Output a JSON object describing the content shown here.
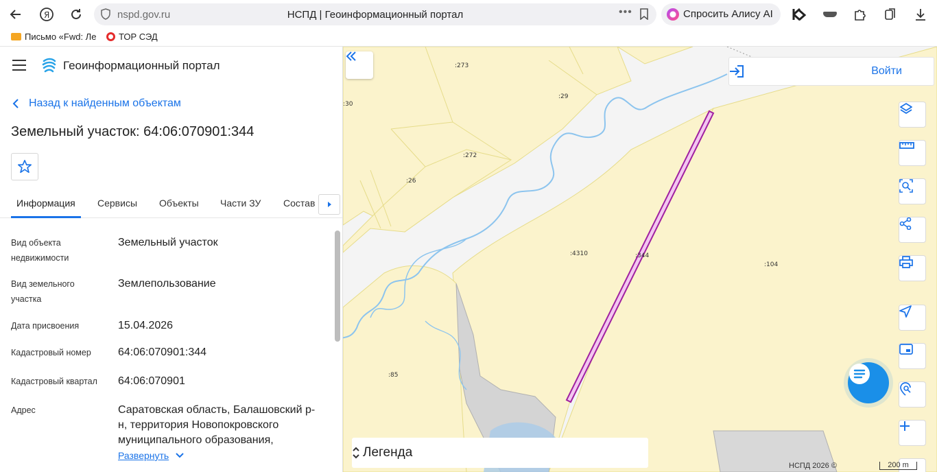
{
  "browser": {
    "url": "nspd.gov.ru",
    "tab_title": "НСПД | Геоинформационный портал",
    "alice_label": "Спросить Алису AI",
    "bookmarks": [
      "Письмо «Fwd: Ле",
      "ТОР СЭД"
    ]
  },
  "panel": {
    "portal_title": "Геоинформационный портал",
    "back_label": "Назад к найденным объектам",
    "object_title": "Земельный участок: 64:06:070901:344",
    "tabs": [
      "Информация",
      "Сервисы",
      "Объекты",
      "Части ЗУ",
      "Состав"
    ],
    "active_tab": "Информация",
    "rows": [
      {
        "label": "Вид объекта недвижимости",
        "value": "Земельный участок"
      },
      {
        "label": "Вид земельного участка",
        "value": "Землепользование"
      },
      {
        "label": "Дата присвоения",
        "value": "15.04.2026"
      },
      {
        "label": "Кадастровый номер",
        "value": "64:06:070901:344"
      },
      {
        "label": "Кадастровый квартал",
        "value": "64:06:070901"
      },
      {
        "label": "Адрес",
        "value": "Саратовская область, Балашовский р-н, территория Новопокровского муниципального образования,"
      }
    ],
    "expand_label": "Развернуть"
  },
  "map": {
    "login_label": "Войти",
    "legend_label": "Легенда",
    "copyright": "НСПД 2026 ©",
    "scale": "200 m",
    "parcel_labels": [
      ":273",
      ":29",
      ":30",
      ":272",
      ":26",
      ":4310",
      ":344",
      ":104",
      ":85"
    ],
    "colors": {
      "parcel_fill": "#fbf3cc",
      "parcel_border": "#e6dc8a",
      "river": "#8cc4ee",
      "highlight": "#a020a0",
      "accent": "#1a73e8"
    }
  }
}
